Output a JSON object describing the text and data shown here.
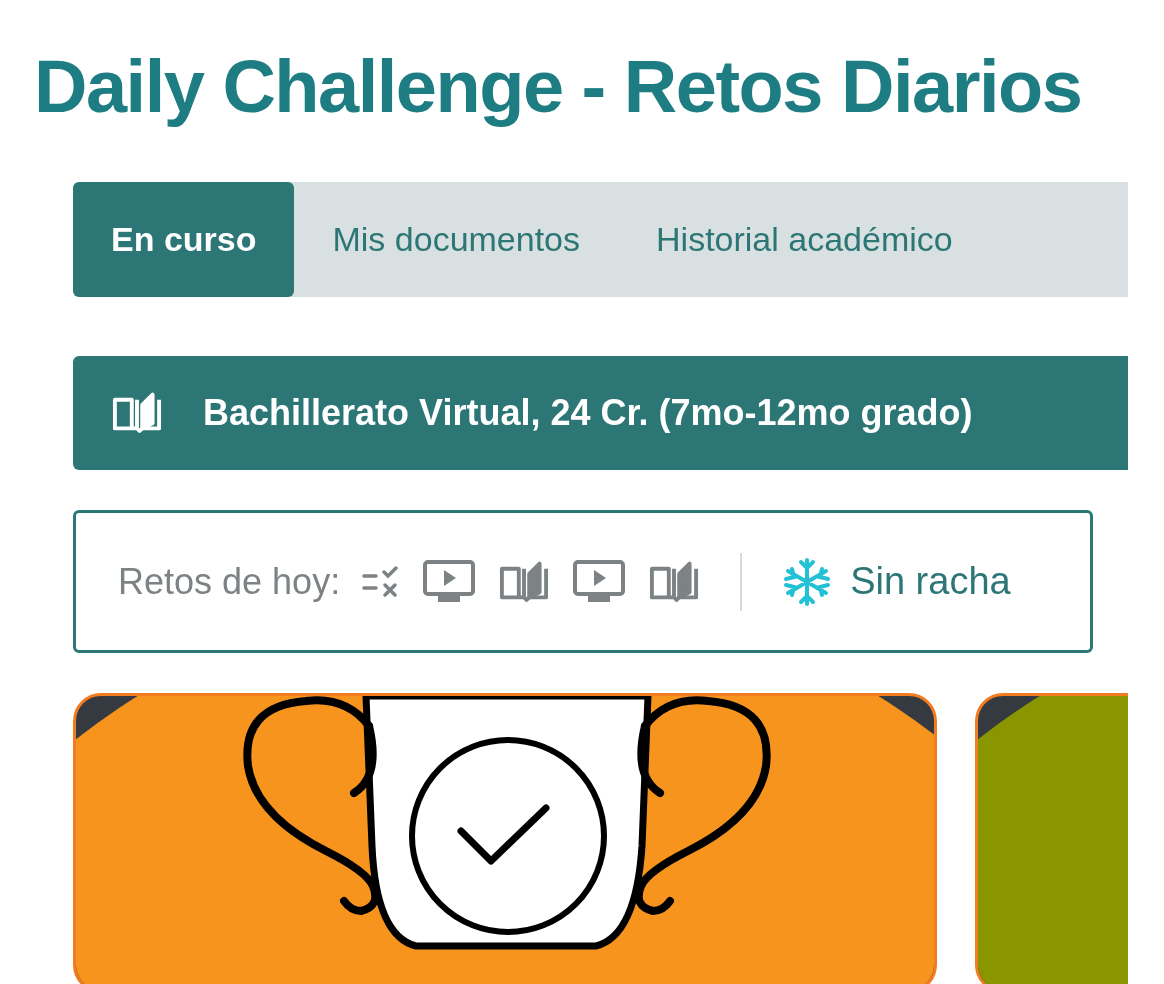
{
  "title": "Daily Challenge - Retos Diarios",
  "tabs": [
    {
      "label": "En curso",
      "selected": true
    },
    {
      "label": "Mis documentos",
      "selected": false
    },
    {
      "label": "Historial académico",
      "selected": false
    }
  ],
  "course": {
    "title": "Bachillerato Virtual, 24 Cr. (7mo-12mo grado)"
  },
  "challenges": {
    "label": "Retos de hoy:",
    "items": [
      {
        "kind": "quiz"
      },
      {
        "kind": "video"
      },
      {
        "kind": "reading"
      },
      {
        "kind": "video"
      },
      {
        "kind": "reading"
      }
    ],
    "streak": "Sin racha"
  },
  "cards": [
    {
      "color": "#f7941d",
      "trophy": true
    },
    {
      "color": "#8a9600",
      "trophy": false
    }
  ]
}
